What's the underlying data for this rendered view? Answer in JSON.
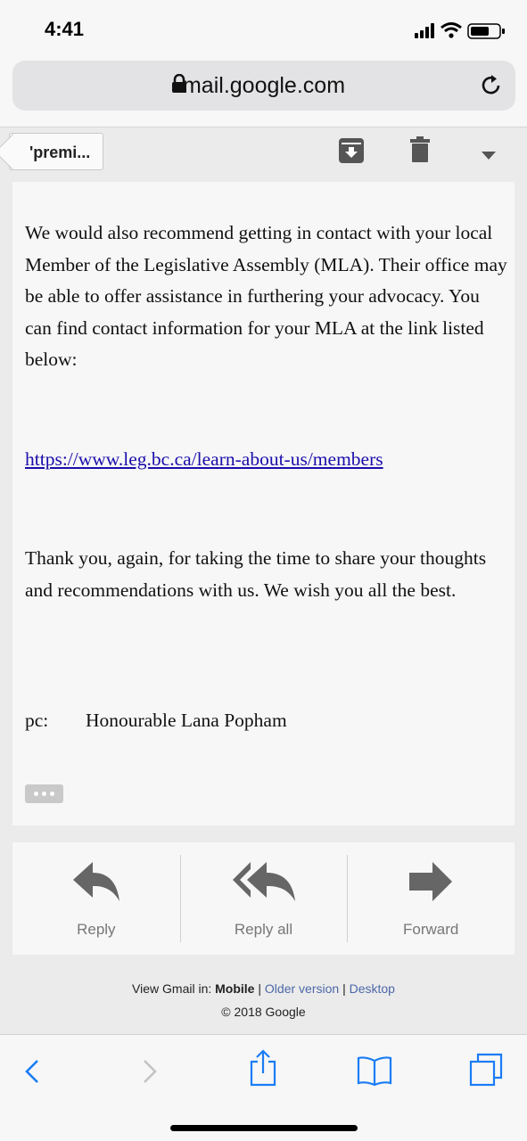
{
  "status_bar": {
    "time": "4:41"
  },
  "browser": {
    "url": "mail.google.com"
  },
  "toolbar": {
    "back_label": "'premi..."
  },
  "message": {
    "paragraphs": [
      "We would also recommend getting in contact with your local Member of the Legislative Assembly (MLA). Their office may be able to offer assistance in furthering your advocacy. You can find contact information for your MLA at the link listed below:",
      "https://www.leg.bc.ca/learn-about-us/members",
      "Thank you, again, for taking the time to share your thoughts and recommendations with us. We wish you all the best."
    ],
    "pc_label": "pc:",
    "pc_value": "Honourable Lana Popham"
  },
  "actions": {
    "reply": "Reply",
    "reply_all": "Reply all",
    "forward": "Forward"
  },
  "footer": {
    "view_label": "View Gmail in:",
    "mobile": "Mobile",
    "older_version": "Older version",
    "desktop": "Desktop",
    "copyright": "© 2018 Google"
  },
  "colors": {
    "link": "#1a0dab",
    "safari_blue": "#1a7cf5",
    "footer_link": "#4c68a8"
  },
  "icons": [
    "lock-icon",
    "reload-icon",
    "archive-icon",
    "trash-icon",
    "chevron-down-icon",
    "reply-icon",
    "reply-all-icon",
    "forward-icon",
    "back-icon",
    "forward-nav-icon",
    "share-icon",
    "bookmarks-icon",
    "tabs-icon"
  ]
}
